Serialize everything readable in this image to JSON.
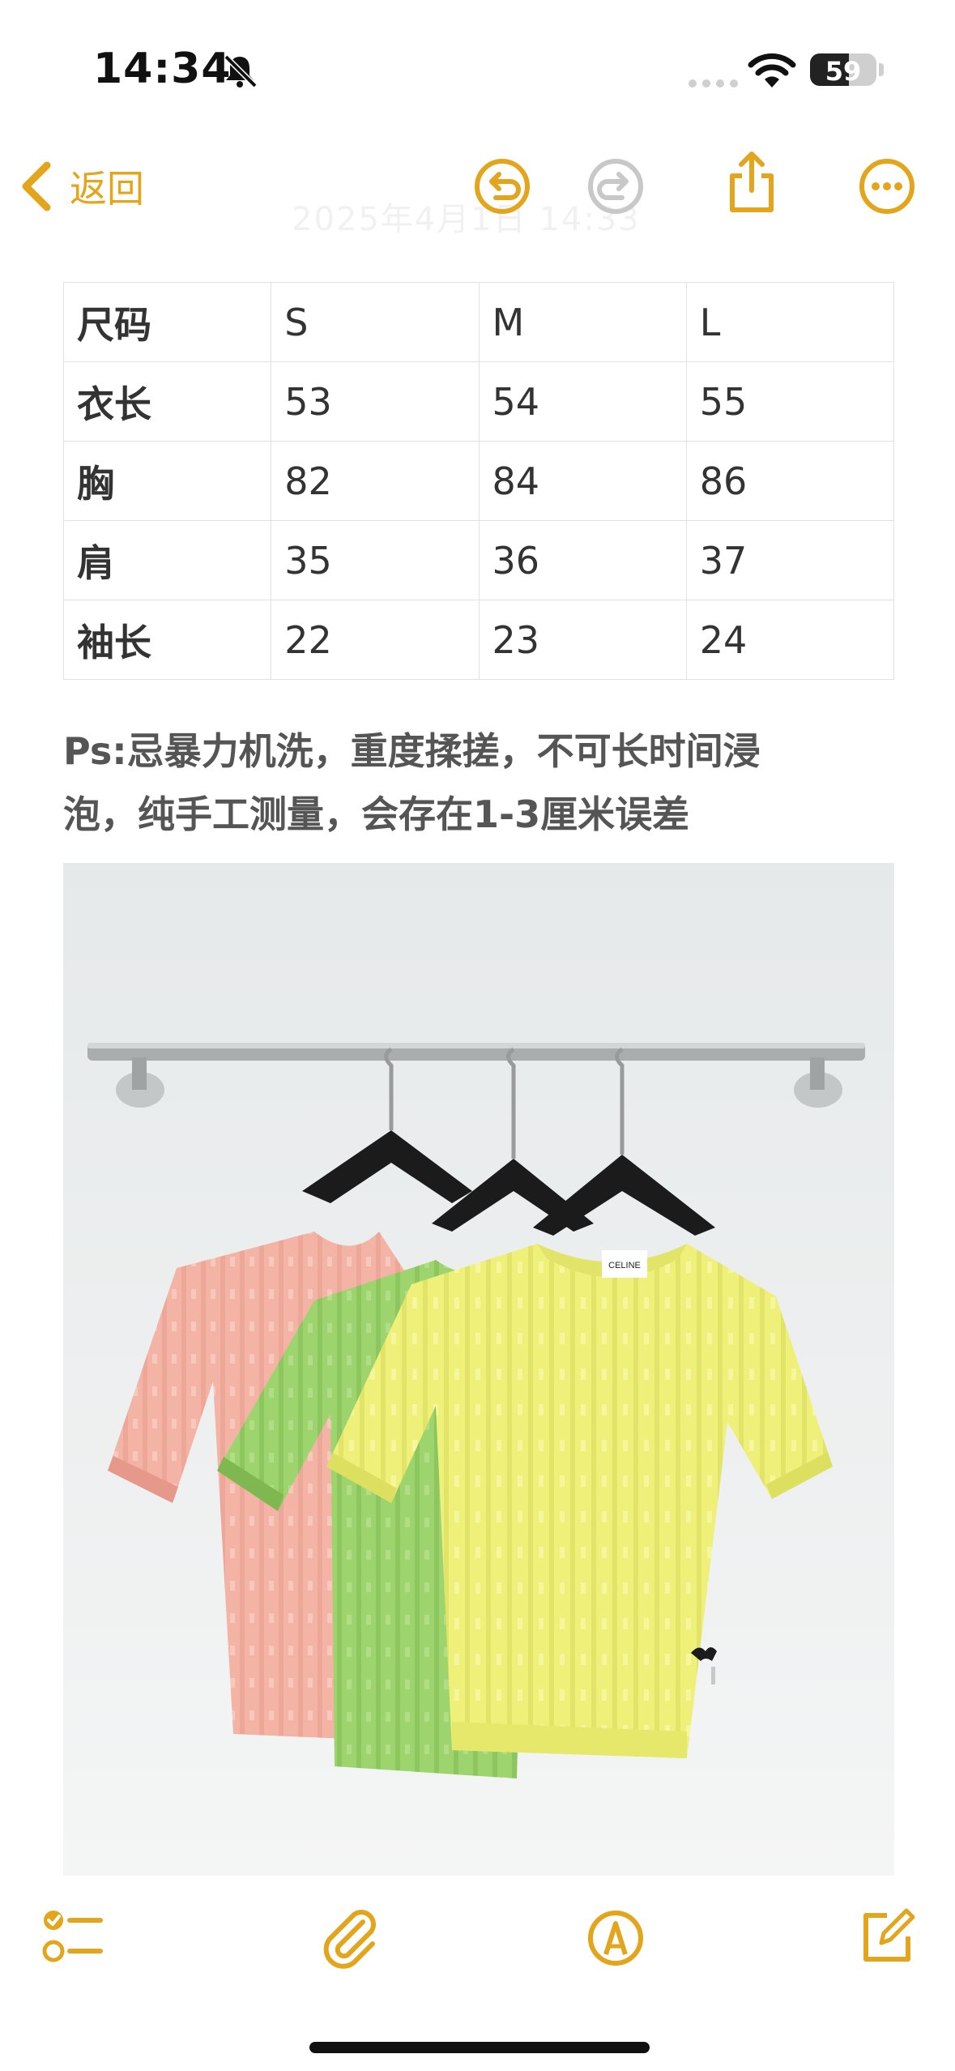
{
  "status_bar": {
    "time": "14:34",
    "battery": "59"
  },
  "nav": {
    "back_label": "返回",
    "date_ghost": "2025年4月1日 14:33"
  },
  "size_table": {
    "rows": [
      [
        "尺码",
        "S",
        "M",
        "L"
      ],
      [
        "衣长",
        "53",
        "54",
        "55"
      ],
      [
        "胸",
        "82",
        "84",
        "86"
      ],
      [
        "肩",
        "35",
        "36",
        "37"
      ],
      [
        "袖长",
        "22",
        "23",
        "24"
      ]
    ]
  },
  "note": {
    "line1": "Ps:忌暴力机洗，重度揉搓，不可长时间浸",
    "line2": "泡，纯手工测量，会存在1-3厘米误差"
  },
  "photo": {
    "label_text": "CELINE"
  },
  "colors": {
    "accent": "#e3a51b",
    "pink": "#f3b4a6",
    "green": "#9ed46e",
    "yellow": "#eef07a"
  },
  "icons": {
    "nav": [
      "chevron-left-icon",
      "undo-icon",
      "redo-icon",
      "share-icon",
      "more-icon"
    ],
    "toolbar": [
      "checklist-icon",
      "attachment-icon",
      "markup-icon",
      "compose-icon"
    ]
  }
}
